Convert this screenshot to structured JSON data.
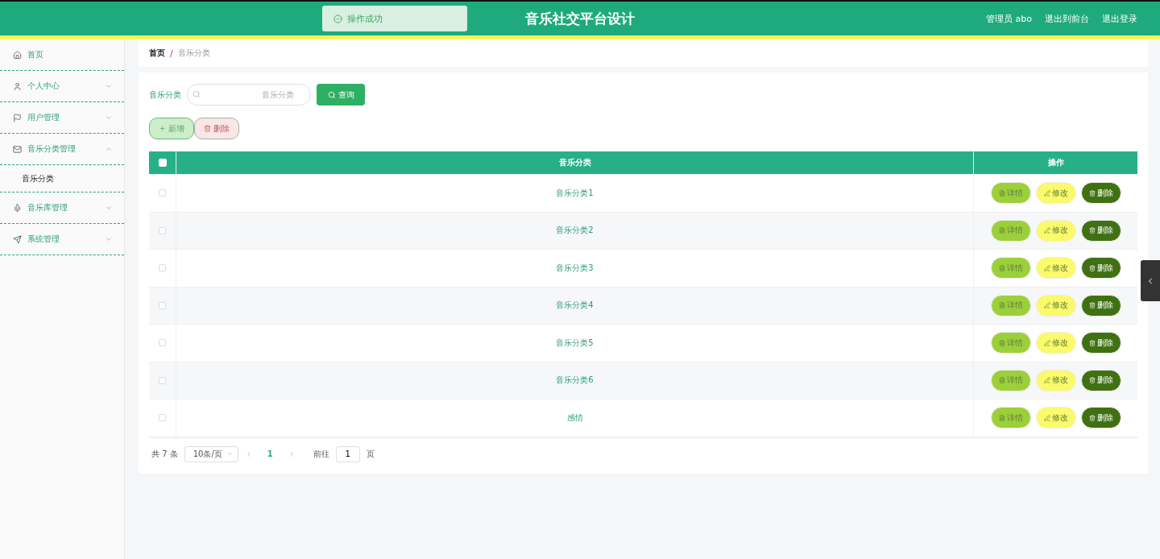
{
  "header": {
    "title": "音乐社交平台设计",
    "toast": "操作成功",
    "links": [
      "管理员 abo",
      "退出到前台",
      "退出登录"
    ]
  },
  "sidebar": {
    "items": [
      {
        "label": "首页"
      },
      {
        "label": "个人中心",
        "expanded": false
      },
      {
        "label": "用户管理",
        "expanded": false
      },
      {
        "label": "音乐分类管理",
        "expanded": true,
        "children": [
          {
            "label": "音乐分类",
            "selected": true
          }
        ]
      },
      {
        "label": "音乐库管理",
        "expanded": false
      },
      {
        "label": "系统管理",
        "expanded": false
      }
    ]
  },
  "breadcrumb": {
    "items": [
      "首页",
      "音乐分类"
    ],
    "separator": "/"
  },
  "search": {
    "label": "音乐分类",
    "placeholder": "音乐分类",
    "button": "查询"
  },
  "actions": [
    "新增",
    "删除"
  ],
  "table": {
    "all_checked": false,
    "columns": [
      "音乐分类",
      "操作"
    ],
    "rows": [
      {
        "name": "音乐分类1",
        "checked": false,
        "buttons": [
          "详情",
          "修改",
          "删除"
        ]
      },
      {
        "name": "音乐分类2",
        "checked": false,
        "buttons": [
          "详情",
          "修改",
          "删除"
        ]
      },
      {
        "name": "音乐分类3",
        "checked": false,
        "buttons": [
          "详情",
          "修改",
          "删除"
        ]
      },
      {
        "name": "音乐分类4",
        "checked": false,
        "buttons": [
          "详情",
          "修改",
          "删除"
        ]
      },
      {
        "name": "音乐分类5",
        "checked": false,
        "buttons": [
          "详情",
          "修改",
          "删除"
        ]
      },
      {
        "name": "音乐分类6",
        "checked": false,
        "buttons": [
          "详情",
          "修改",
          "删除"
        ]
      },
      {
        "name": "感情",
        "checked": false,
        "buttons": [
          "详情",
          "修改",
          "删除"
        ]
      }
    ]
  },
  "pagination": {
    "total": "共 7 条",
    "page_size": "10条/页",
    "pages": [
      {
        "label": "1",
        "selected": true
      }
    ],
    "goto": "前往",
    "goto_value": "1",
    "goto_suffix": "页"
  }
}
